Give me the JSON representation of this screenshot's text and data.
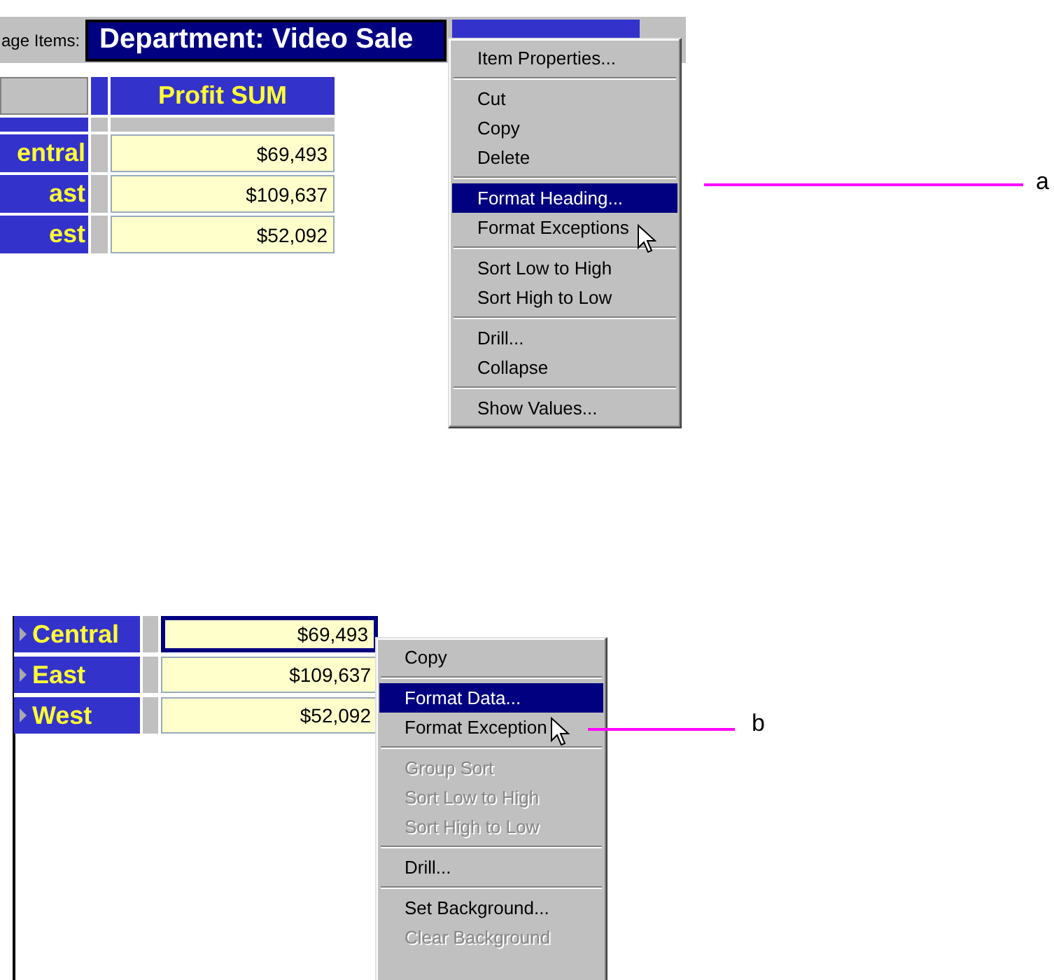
{
  "top_screen": {
    "page_items": {
      "label": "age Items:",
      "items": [
        {
          "text": "Department: Video Sale",
          "selected": true
        },
        {
          "selected": false
        }
      ]
    },
    "table": {
      "column_header": "Profit SUM",
      "rows": [
        {
          "label": "entral",
          "value": "$69,493",
          "selected": false
        },
        {
          "label": "ast",
          "value": "$109,637",
          "selected": false
        },
        {
          "label": "est",
          "value": "$52,092",
          "selected": false
        }
      ]
    },
    "menu": [
      {
        "kind": "item",
        "label": "Item Properties...",
        "selected": false,
        "disabled": false
      },
      {
        "kind": "separator"
      },
      {
        "kind": "item",
        "label": "Cut",
        "selected": false,
        "disabled": false
      },
      {
        "kind": "item",
        "label": "Copy",
        "selected": false,
        "disabled": false
      },
      {
        "kind": "item",
        "label": "Delete",
        "selected": false,
        "disabled": false
      },
      {
        "kind": "separator"
      },
      {
        "kind": "item",
        "label": "Format Heading...",
        "selected": true,
        "disabled": false
      },
      {
        "kind": "item",
        "label": "Format Exceptions",
        "selected": false,
        "disabled": false
      },
      {
        "kind": "separator"
      },
      {
        "kind": "item",
        "label": "Sort Low to High",
        "selected": false,
        "disabled": false
      },
      {
        "kind": "item",
        "label": "Sort High to Low",
        "selected": false,
        "disabled": false
      },
      {
        "kind": "separator"
      },
      {
        "kind": "item",
        "label": "Drill...",
        "selected": false,
        "disabled": false
      },
      {
        "kind": "item",
        "label": "Collapse",
        "selected": false,
        "disabled": false
      },
      {
        "kind": "separator"
      },
      {
        "kind": "item",
        "label": "Show Values...",
        "selected": false,
        "disabled": false
      }
    ],
    "callout": "a"
  },
  "bottom_screen": {
    "table": {
      "rows": [
        {
          "label": "Central",
          "value": "$69,493",
          "selected": true
        },
        {
          "label": "East",
          "value": "$109,637",
          "selected": false
        },
        {
          "label": "West",
          "value": "$52,092",
          "selected": false
        }
      ]
    },
    "menu": [
      {
        "kind": "item",
        "label": "Copy",
        "selected": false,
        "disabled": false
      },
      {
        "kind": "separator"
      },
      {
        "kind": "item",
        "label": "Format Data...",
        "selected": true,
        "disabled": false
      },
      {
        "kind": "item",
        "label": "Format Exception",
        "selected": false,
        "disabled": false
      },
      {
        "kind": "separator"
      },
      {
        "kind": "item",
        "label": "Group Sort",
        "selected": false,
        "disabled": true
      },
      {
        "kind": "item",
        "label": "Sort Low to High",
        "selected": false,
        "disabled": true
      },
      {
        "kind": "item",
        "label": "Sort High to Low",
        "selected": false,
        "disabled": true
      },
      {
        "kind": "separator"
      },
      {
        "kind": "item",
        "label": "Drill...",
        "selected": false,
        "disabled": false
      },
      {
        "kind": "separator"
      },
      {
        "kind": "item",
        "label": "Set Background...",
        "selected": false,
        "disabled": false
      },
      {
        "kind": "item",
        "label": "Clear Background",
        "selected": false,
        "disabled": true
      }
    ],
    "callout": "b"
  }
}
